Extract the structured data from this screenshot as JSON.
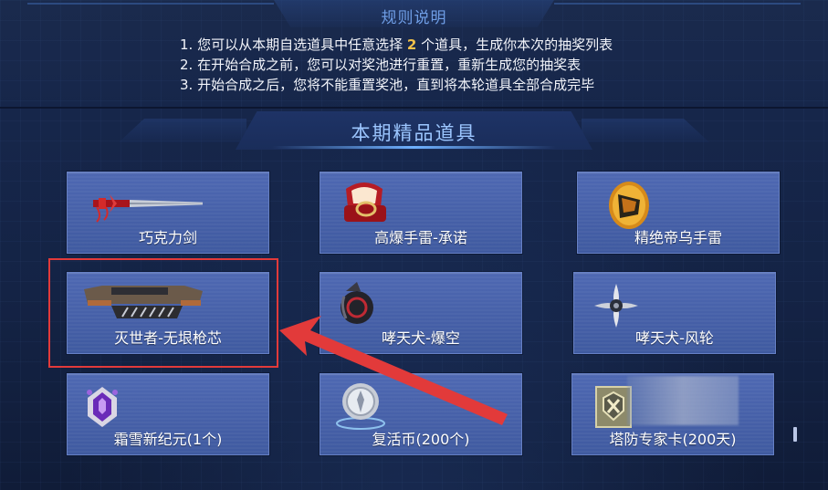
{
  "rules": {
    "title": "规则说明",
    "line1_pre": "1. 您可以从本期自选道具中任意选择 ",
    "line1_num": "2",
    "line1_post": " 个道具，生成你本次的抽奖列表",
    "line2": "2. 在开始合成之前，您可以对奖池进行重置，重新生成您的抽奖表",
    "line3": "3. 开始合成之后，您将不能重置奖池，直到将本轮道具全部合成完毕"
  },
  "featured": {
    "title": "本期精品道具"
  },
  "items": [
    {
      "label": "巧克力剑",
      "icon": "sword-icon"
    },
    {
      "label": "高爆手雷-承诺",
      "icon": "ring-box-grenade-icon"
    },
    {
      "label": "精绝帝乌手雷",
      "icon": "golden-egg-grenade-icon"
    },
    {
      "label": "灭世者-无垠枪芯",
      "icon": "gun-core-icon"
    },
    {
      "label": "哮天犬-爆空",
      "icon": "dark-grenade-icon"
    },
    {
      "label": "哮天犬-风轮",
      "icon": "shuriken-icon"
    },
    {
      "label": "霜雪新纪元(1个)",
      "icon": "purple-gem-crest-icon"
    },
    {
      "label": "复活币(200个)",
      "icon": "silver-coin-icon"
    },
    {
      "label": "塔防专家卡(200天)",
      "icon": "tower-defense-card-icon"
    }
  ],
  "colors": {
    "accent_highlight": "#e23a3a",
    "rule_number": "#f2c24a",
    "card_bg": "#4e68b2"
  }
}
